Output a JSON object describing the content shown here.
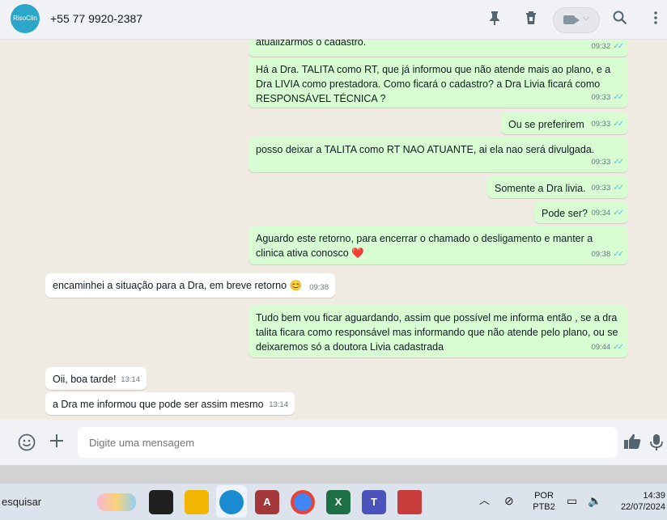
{
  "header": {
    "avatar_text": "RisoClin",
    "contact_name": "+55 77 9920-2387"
  },
  "messages": [
    {
      "dir": "out",
      "text": "atualizarmos o cadastro.",
      "time": "09:32",
      "ticks": "✓✓"
    },
    {
      "dir": "out",
      "text": "Há a Dra. TALITA como RT, que já informou que não atende mais ao plano, e a Dra LIVIA como prestadora. Como ficará o cadastro? a Dra Livia ficará como RESPONSÁVEL TÉCNICA ?",
      "time": "09:33",
      "ticks": "✓✓"
    },
    {
      "dir": "out",
      "text": "Ou se preferirem",
      "time": "09:33",
      "ticks": "✓✓"
    },
    {
      "dir": "out",
      "text": "posso deixar a TALITA como RT NAO ATUANTE, ai ela nao será divulgada.",
      "time": "09:33",
      "ticks": "✓✓"
    },
    {
      "dir": "out",
      "text": "Somente a Dra livia.",
      "time": "09:33",
      "ticks": "✓✓"
    },
    {
      "dir": "out",
      "text": "Pode ser?",
      "time": "09:34",
      "ticks": "✓✓"
    },
    {
      "dir": "out",
      "text": "Aguardo este retorno, para encerrar o chamado o desligamento e manter a clinica ativa conosco ❤️",
      "time": "09:38",
      "ticks": "✓✓"
    },
    {
      "dir": "in",
      "text": "encaminhei a situação para a Dra, em breve retorno 😊",
      "time": "09:38"
    },
    {
      "dir": "out",
      "text": "Tudo bem vou ficar aguardando, assim que possível me informa então , se a dra talita ficara como responsável mas informando que não atende pelo plano, ou se deixaremos só a doutora Livia cadastrada",
      "time": "09:44",
      "ticks": "✓✓"
    },
    {
      "dir": "in",
      "text": "Oii, boa tarde!",
      "time": "13:14"
    },
    {
      "dir": "in",
      "text": "a Dra me informou que pode ser assim mesmo",
      "time": "13:14"
    }
  ],
  "composer": {
    "placeholder": "Digite uma mensagem"
  },
  "taskbar": {
    "search_text": "esquisar",
    "language_top": "POR",
    "language_bottom": "PTB2",
    "time": "14:39",
    "date": "22/07/2024",
    "apps": [
      "task-view",
      "file-explorer",
      "edge",
      "access",
      "chrome",
      "excel",
      "teams",
      "snipping-tool"
    ]
  },
  "icons": {
    "pin": "pin-icon",
    "trash": "trash-icon",
    "video": "video-call-icon",
    "search": "search-icon",
    "menu": "menu-icon",
    "emoji": "emoji-icon",
    "attach": "plus-icon",
    "thumb": "thumbs-up-icon",
    "mic": "mic-icon"
  },
  "colors": {
    "outgoing_bubble": "#d9fdd3",
    "incoming_bubble": "#ffffff",
    "chat_bg": "#efeae2",
    "ticks": "#53bdeb",
    "header_bg": "#f0f2f5"
  }
}
